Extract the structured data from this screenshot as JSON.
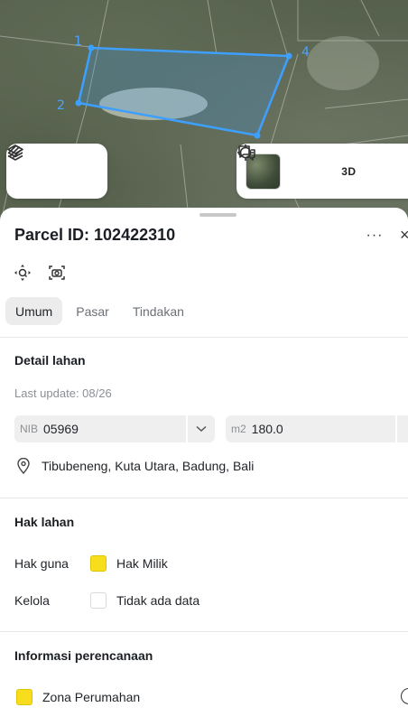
{
  "map": {
    "vertex_labels": [
      "1",
      "2",
      "3",
      "4"
    ],
    "parcel_color": "#3da0ff",
    "toolbar_left": {
      "icons": [
        "layers-icon",
        "draw-path-icon"
      ]
    },
    "toolbar_right": {
      "icons": [
        "satellite-thumbnail",
        "crosshair-icon",
        "3d-toggle",
        "message-share-icon"
      ],
      "label_3d": "3D"
    }
  },
  "sheet": {
    "title": "Parcel ID: 102422310",
    "more_label": "···",
    "close_label": "×",
    "tabs": [
      {
        "label": "Umum",
        "active": true
      },
      {
        "label": "Pasar",
        "active": false
      },
      {
        "label": "Tindakan",
        "active": false
      }
    ],
    "detail": {
      "heading": "Detail lahan",
      "last_update": "Last update: 08/26",
      "nib_label": "NIB",
      "nib_value": "05969",
      "area_label": "m2",
      "area_value": "180.0",
      "address": "Tibubeneng, Kuta Utara, Badung, Bali"
    },
    "rights": {
      "heading": "Hak lahan",
      "rows": [
        {
          "label": "Hak guna",
          "value": "Hak Milik",
          "color": "#f7dd1b"
        },
        {
          "label": "Kelola",
          "value": "Tidak ada data",
          "color": "#ffffff"
        }
      ]
    },
    "planning": {
      "heading": "Informasi perencanaan",
      "zone": "Zona Perumahan",
      "zone_color": "#f7dd1b"
    }
  }
}
